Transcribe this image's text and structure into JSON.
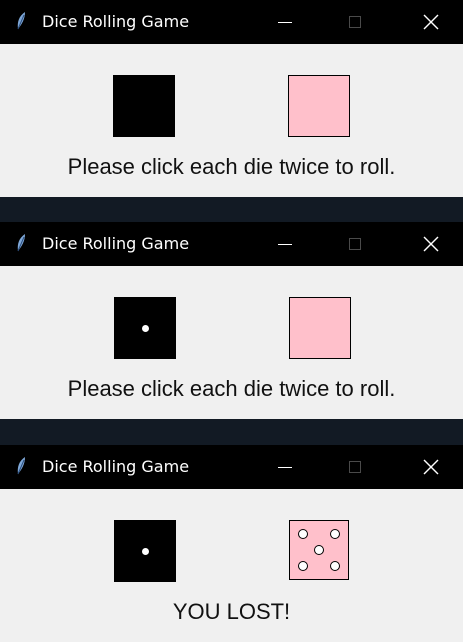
{
  "windows": [
    {
      "title": "Dice Rolling Game",
      "message": "Please click each die twice to roll.",
      "left_die": {
        "color": "#000000",
        "face": 0
      },
      "right_die": {
        "color": "#ffc0cb",
        "face": 0
      }
    },
    {
      "title": "Dice Rolling Game",
      "message": "Please click each die twice to roll.",
      "left_die": {
        "color": "#000000",
        "face": 1
      },
      "right_die": {
        "color": "#ffc0cb",
        "face": 0
      }
    },
    {
      "title": "Dice Rolling Game",
      "message": "YOU LOST!",
      "left_die": {
        "color": "#000000",
        "face": 1
      },
      "right_die": {
        "color": "#ffc0cb",
        "face": 5
      }
    }
  ],
  "icons": {
    "app": "feather-icon",
    "minimize": "minimize-icon",
    "maximize": "maximize-icon",
    "close": "close-icon"
  }
}
